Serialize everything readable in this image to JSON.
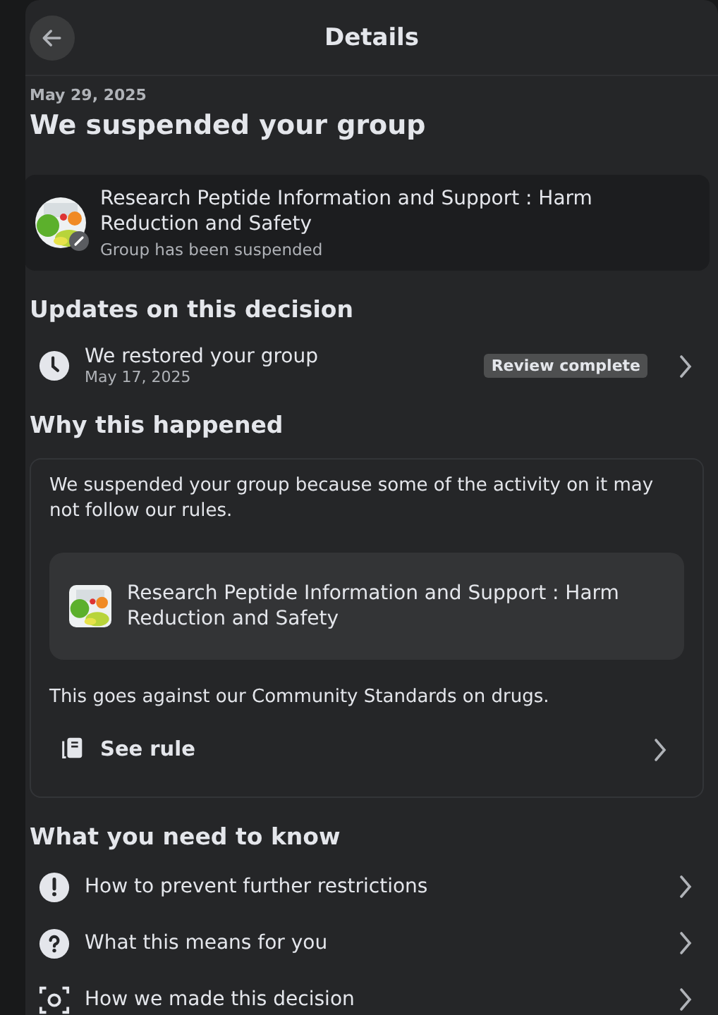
{
  "header": {
    "title": "Details"
  },
  "date": "May 29, 2025",
  "title": "We suspended your group",
  "group": {
    "name": "Research Peptide Information and Support : Harm Reduction and Safety",
    "status": "Group has been suspended"
  },
  "updates": {
    "heading": "Updates on this decision",
    "items": [
      {
        "title": "We restored your group",
        "date": "May 17, 2025",
        "badge": "Review complete"
      }
    ]
  },
  "why": {
    "heading": "Why this happened",
    "text": "We suspended your group because some of the activity on it may not follow our rules.",
    "group_name": "Research Peptide Information and Support : Harm Reduction and Safety",
    "standard": "This goes against our Community Standards on drugs.",
    "link": "See rule"
  },
  "know": {
    "heading": "What you need to know",
    "items": [
      {
        "kind": "alert",
        "label": "How to prevent further restrictions"
      },
      {
        "kind": "question",
        "label": "What this means for you"
      },
      {
        "kind": "scan",
        "label": "How we made this decision"
      }
    ]
  }
}
